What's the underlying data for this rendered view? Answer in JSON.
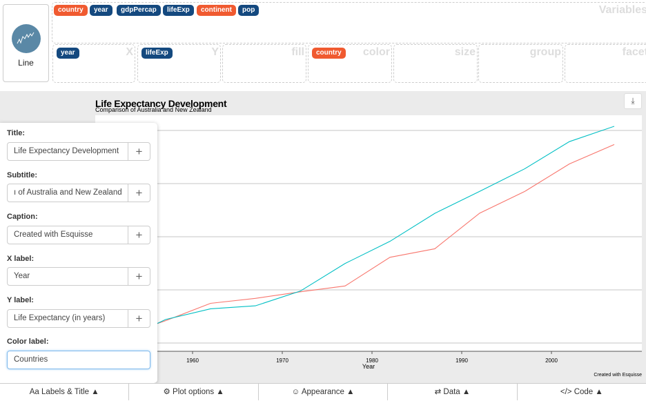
{
  "chart_type": {
    "label": "Line",
    "icon": "line-chart-icon"
  },
  "variables": {
    "zone_label": "Variables",
    "items": [
      {
        "name": "country",
        "color": "#f05a30"
      },
      {
        "name": "year",
        "color": "#14497f"
      },
      {
        "name": "gdpPercap",
        "color": "#14497f"
      },
      {
        "name": "lifeExp",
        "color": "#14497f"
      },
      {
        "name": "continent",
        "color": "#f05a30"
      },
      {
        "name": "pop",
        "color": "#14497f"
      }
    ]
  },
  "zones": [
    {
      "label": "X",
      "value": "year"
    },
    {
      "label": "Y",
      "value": "lifeExp"
    },
    {
      "label": "fill",
      "value": ""
    },
    {
      "label": "color",
      "value": "country"
    },
    {
      "label": "size",
      "value": ""
    },
    {
      "label": "group",
      "value": ""
    },
    {
      "label": "facet",
      "value": ""
    }
  ],
  "labels_panel": {
    "title": {
      "label": "Title:",
      "value": "Life Expectancy Development"
    },
    "subtitle": {
      "label": "Subtitle:",
      "value": "ı of Australia and New Zealand"
    },
    "caption": {
      "label": "Caption:",
      "value": "Created with Esquisse"
    },
    "xlabel": {
      "label": "X label:",
      "value": "Year"
    },
    "ylabel": {
      "label": "Y label:",
      "value": "Life Expectancy (in years)"
    },
    "colorlabel": {
      "label": "Color label:",
      "value": "Countries"
    },
    "add_symbol": "+"
  },
  "tabs": [
    {
      "icon": "Aa",
      "label": "Labels & Title ▲"
    },
    {
      "icon": "⚙",
      "label": "Plot options ▲"
    },
    {
      "icon": "☺",
      "label": "Appearance ▲"
    },
    {
      "icon": "⇄",
      "label": "Data ▲"
    },
    {
      "icon": "</>",
      "label": "Code ▲"
    }
  ],
  "download_icon": "⤓",
  "chart_data": {
    "type": "line",
    "title": "Life Expectancy Development",
    "subtitle": "Comparison of Australia and New Zealand",
    "caption": "Created with Esquisse",
    "xlabel": "Year",
    "x": [
      1952,
      1957,
      1962,
      1967,
      1972,
      1977,
      1982,
      1987,
      1992,
      1997,
      2002,
      2007
    ],
    "xticks": [
      "1960",
      "1970",
      "1980",
      "1990",
      "2000"
    ],
    "xlim": [
      1952,
      2007
    ],
    "ylim": [
      68.5,
      81.5
    ],
    "ygrid": [
      69,
      72,
      75,
      78,
      81
    ],
    "grid": true,
    "legend": "hidden",
    "series": [
      {
        "color": "#f8766d",
        "values": [
          69.39,
          70.26,
          71.24,
          71.52,
          71.89,
          72.22,
          73.84,
          74.32,
          76.33,
          77.55,
          79.11,
          80.204
        ]
      },
      {
        "color": "#00bfc4",
        "values": [
          69.12,
          70.33,
          70.93,
          71.1,
          71.93,
          73.49,
          74.74,
          76.32,
          77.56,
          78.83,
          80.37,
          81.235
        ]
      }
    ]
  }
}
